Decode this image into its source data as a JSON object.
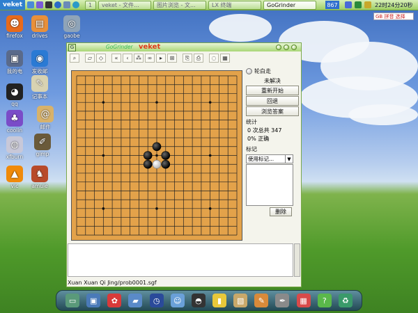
{
  "taskbar": {
    "start_label": "veket",
    "workspace": "1",
    "tasks": [
      "veket - 文件...",
      "图片浏览 - 文...",
      "LX 终端",
      "GoGrinder"
    ],
    "cpu": "867",
    "clock": "22时24分20秒"
  },
  "ime_label": "GB 拼音 选择",
  "desktop_icons": [
    {
      "label": "firefox",
      "icon": "firefox-icon",
      "color": "#e86a1a",
      "glyph": "☻"
    },
    {
      "label": "drives",
      "icon": "drive-icon",
      "color": "#e8903a",
      "glyph": "▤"
    },
    {
      "label": "gaobe",
      "icon": "gaobe-icon",
      "color": "#8fa4b8",
      "glyph": "◎"
    },
    {
      "label": "我的电",
      "icon": "computer-icon",
      "color": "#5a6a8a",
      "glyph": "▣"
    },
    {
      "label": "发收邮",
      "icon": "mail-icon",
      "color": "#2a7ad4",
      "glyph": "◉"
    },
    {
      "label": "qq",
      "icon": "qq-icon",
      "color": "#222",
      "glyph": "◕"
    },
    {
      "label": "记事本",
      "icon": "notepad-icon",
      "color": "#d8d2b2",
      "glyph": "✎"
    },
    {
      "label": "coolin",
      "icon": "coolin-icon",
      "color": "#7a4cc8",
      "glyph": "♣"
    },
    {
      "label": "邮件",
      "icon": "email-icon",
      "color": "#d8b26a",
      "glyph": "@"
    },
    {
      "label": "xfburn",
      "icon": "burn-icon",
      "color": "#c8c8d8",
      "glyph": "◍"
    },
    {
      "label": "gimp",
      "icon": "gimp-icon",
      "color": "#6a5a3a",
      "glyph": "✐"
    },
    {
      "label": "vlc",
      "icon": "vlc-icon",
      "color": "#f08a0a",
      "glyph": "▲"
    },
    {
      "label": "amule",
      "icon": "amule-icon",
      "color": "#b84a2a",
      "glyph": "♞"
    }
  ],
  "window": {
    "title": "GoGrinder",
    "brand": "veket"
  },
  "toolbar_tools": [
    {
      "name": "find-tool-button",
      "icon": "magnifier-icon",
      "glyph": "⌕"
    },
    {
      "name": "load-tool-button",
      "icon": "folder-icon",
      "glyph": "▱"
    },
    {
      "name": "open-tool-button",
      "icon": "open-icon",
      "glyph": "◇"
    },
    {
      "name": "first-tool-button",
      "icon": "first-icon",
      "glyph": "«"
    },
    {
      "name": "prev-tool-button",
      "icon": "prev-icon",
      "glyph": "‹"
    },
    {
      "name": "random-tool-button",
      "icon": "random-icon",
      "glyph": "⁂"
    },
    {
      "name": "next-problem-button",
      "icon": "binoculars-icon",
      "glyph": "∞"
    },
    {
      "name": "play-tool-button",
      "icon": "play-icon",
      "glyph": "▸"
    },
    {
      "name": "mark-tool-button",
      "icon": "mark-icon",
      "glyph": "⊞"
    },
    {
      "name": "copy-tool-button",
      "icon": "copy-icon",
      "glyph": "⎘"
    },
    {
      "name": "print-tool-button",
      "icon": "print-icon",
      "glyph": "⎙"
    },
    {
      "name": "comment-tool-button",
      "icon": "speech-icon",
      "glyph": "◌"
    },
    {
      "name": "settings-tool-button",
      "icon": "settings-icon",
      "glyph": "▦"
    }
  ],
  "board": {
    "size": 19,
    "hoshi": [
      [
        3,
        3
      ],
      [
        9,
        3
      ],
      [
        15,
        3
      ],
      [
        3,
        9
      ],
      [
        9,
        9
      ],
      [
        15,
        9
      ],
      [
        3,
        15
      ],
      [
        9,
        15
      ],
      [
        15,
        15
      ]
    ],
    "stones": [
      {
        "x": 9,
        "y": 8,
        "color": "black"
      },
      {
        "x": 8,
        "y": 9,
        "color": "black"
      },
      {
        "x": 10,
        "y": 9,
        "color": "black"
      },
      {
        "x": 8,
        "y": 10,
        "color": "black"
      },
      {
        "x": 9,
        "y": 10,
        "color": "white"
      },
      {
        "x": 10,
        "y": 10,
        "color": "black"
      }
    ]
  },
  "side": {
    "turn": "轮白走",
    "status": "未解决",
    "buttons": [
      "重新开始",
      "回退",
      "浏览答案"
    ],
    "stats_label": "统计",
    "stats": [
      "0 次总共 347",
      "0% 正确"
    ],
    "mark_label": "标记",
    "mark_select": "使用标记...",
    "delete": "删除"
  },
  "status_bar": "Xuan Xuan Qi Jing/prob0001.sgf",
  "dock_icons": [
    {
      "icon": "monitor-icon",
      "color": "#5a9a7a",
      "glyph": "▭"
    },
    {
      "icon": "display-icon",
      "color": "#4a7ab8",
      "glyph": "▣"
    },
    {
      "icon": "network-icon",
      "color": "#d83a3a",
      "glyph": "✿"
    },
    {
      "icon": "files-icon",
      "color": "#5a8ac8",
      "glyph": "▰"
    },
    {
      "icon": "clock-icon",
      "color": "#2a4a9a",
      "glyph": "◷"
    },
    {
      "icon": "people-icon",
      "color": "#6aa0d8",
      "glyph": "☺"
    },
    {
      "icon": "penguin-icon",
      "color": "#333",
      "glyph": "◓"
    },
    {
      "icon": "exit-icon",
      "color": "#e8c83a",
      "glyph": "▮"
    },
    {
      "icon": "photo-icon",
      "color": "#c8a86a",
      "glyph": "▧"
    },
    {
      "icon": "paint-icon",
      "color": "#d88a3a",
      "glyph": "✎"
    },
    {
      "icon": "pen-icon",
      "color": "#8a8a8a",
      "glyph": "✒"
    },
    {
      "icon": "calendar-icon",
      "color": "#d84a4a",
      "glyph": "▦"
    },
    {
      "icon": "help-icon",
      "color": "#5ab84a",
      "glyph": "?"
    },
    {
      "icon": "recycle-icon",
      "color": "#3a9a6a",
      "glyph": "♻"
    }
  ]
}
